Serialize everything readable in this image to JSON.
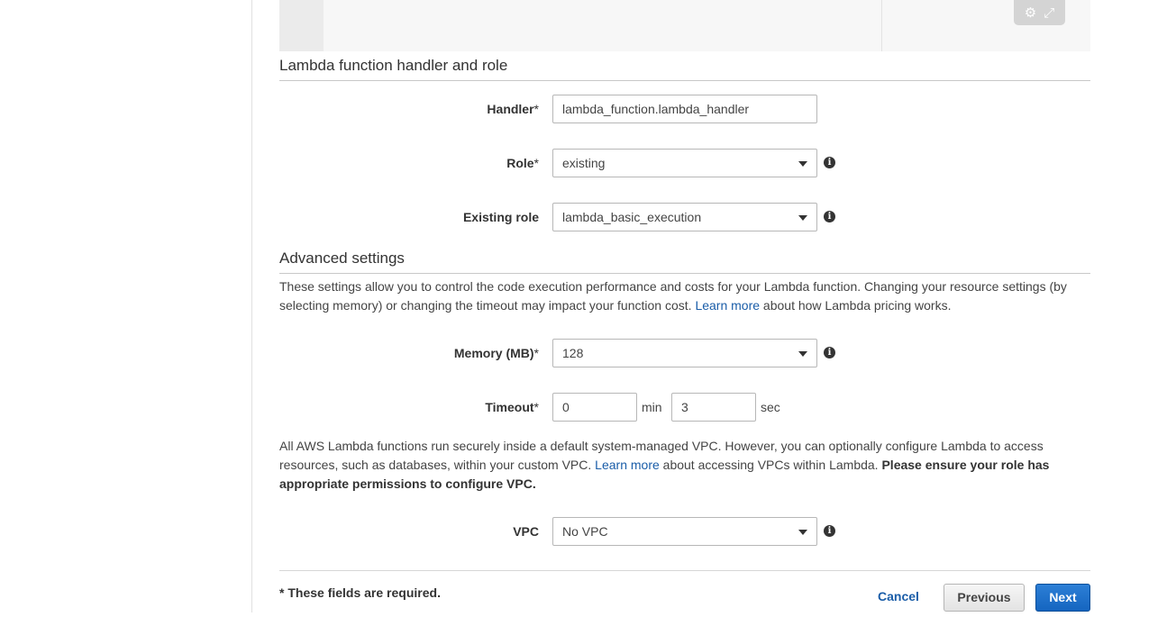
{
  "editor": {
    "settings_icon": "gear-icon",
    "fullscreen_icon": "expand-icon"
  },
  "handler_section": {
    "title": "Lambda function handler and role",
    "handler": {
      "label": "Handler",
      "required": "*",
      "value": "lambda_function.lambda_handler"
    },
    "role": {
      "label": "Role",
      "required": "*",
      "value": "existing"
    },
    "existing_role": {
      "label": "Existing role",
      "value": "lambda_basic_execution"
    }
  },
  "advanced": {
    "title": "Advanced settings",
    "desc_part1": "These settings allow you to control the code execution performance and costs for your Lambda function. Changing your resource settings (by selecting memory) or changing the timeout may impact your function cost. ",
    "desc_link": "Learn more",
    "desc_part2": " about how Lambda pricing works.",
    "memory": {
      "label": "Memory (MB)",
      "required": "*",
      "value": "128"
    },
    "timeout": {
      "label": "Timeout",
      "required": "*",
      "min_value": "0",
      "min_unit": "min",
      "sec_value": "3",
      "sec_unit": "sec"
    },
    "vpc_part1": "All AWS Lambda functions run securely inside a default system-managed VPC. However, you can optionally configure Lambda to access resources, such as databases, within your custom VPC. ",
    "vpc_link": "Learn more",
    "vpc_part2": " about accessing VPCs within Lambda. ",
    "vpc_bold": "Please ensure your role has appropriate permissions to configure VPC.",
    "vpc": {
      "label": "VPC",
      "value": "No VPC"
    }
  },
  "footer": {
    "required_note": "* These fields are required.",
    "cancel": "Cancel",
    "previous": "Previous",
    "next": "Next"
  },
  "info_icon": "i",
  "colors": {
    "link": "#1a5da8",
    "primary_button": "#1565c0"
  }
}
